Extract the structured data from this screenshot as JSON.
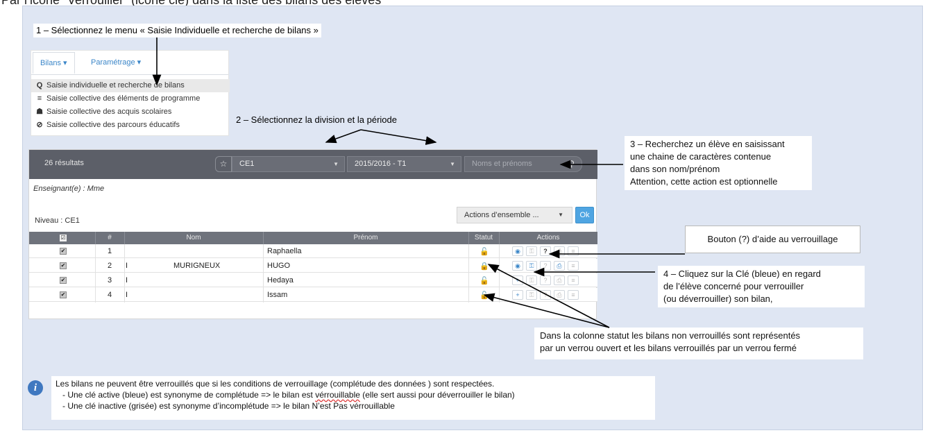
{
  "page_title": "Par l’icône “Verrouiller” (icône clé) dans la liste des bilans des élèves",
  "callouts": {
    "step1": "1 – Sélectionnez le menu « Saisie Individuelle et recherche de bilans »",
    "step2": "2 – Sélectionnez la division et la période",
    "step3_lines": [
      "3 – Recherchez un élève en saisissant",
      "une chaine de caractères contenue",
      "dans son nom/prénom",
      "Attention, cette action est optionnelle"
    ],
    "help_button": "Bouton (?) d’aide au verrouillage",
    "step4_lines": [
      "4 – Cliquez sur la Clé (bleue) en regard",
      "de l’élève concerné pour verrouiller",
      "(ou déverrouiller) son bilan,"
    ],
    "status_lines": [
      "Dans la colonne statut les bilans non verrouillés sont représentés",
      "par un verrou ouvert et les bilans verrouillés par un verrou fermé"
    ]
  },
  "menu": {
    "tabs": [
      {
        "label": "Bilans ▾"
      },
      {
        "label": "Paramétrage ▾"
      }
    ],
    "items": [
      {
        "icon": "search-icon",
        "glyph": "Q",
        "label": "Saisie individuelle et recherche de bilans"
      },
      {
        "icon": "list-icon",
        "glyph": "≡",
        "label": "Saisie collective des éléments de programme"
      },
      {
        "icon": "users-icon",
        "glyph": "☗",
        "label": "Saisie collective des acquis scolaires"
      },
      {
        "icon": "compass-icon",
        "glyph": "⊘",
        "label": "Saisie collective des parcours éducatifs"
      }
    ]
  },
  "app": {
    "results": "26 résultats",
    "division": "CE1",
    "period": "2015/2016 - T1",
    "search_placeholder": "Noms et prénoms",
    "teacher": "Enseignant(e) : Mme",
    "actions_label": "Actions d’ensemble ...",
    "ok_label": "Ok",
    "niveau": "Niveau : CE1",
    "columns": [
      "☑",
      "#",
      "Nom",
      "Prénom",
      "Statut",
      "Actions"
    ],
    "rows": [
      {
        "num": "1",
        "initial": "",
        "nom": "",
        "prenom": "Raphaella",
        "status": "open"
      },
      {
        "num": "2",
        "initial": "I",
        "nom": "MURIGNEUX",
        "prenom": "HUGO",
        "status": "locked"
      },
      {
        "num": "3",
        "initial": "I",
        "nom": "",
        "prenom": "Hedaya",
        "status": "open"
      },
      {
        "num": "4",
        "initial": "I",
        "nom": "",
        "prenom": "Issam",
        "status": "open"
      }
    ]
  },
  "info": {
    "line1": "Les bilans ne peuvent être verrouillés que si les conditions de verrouillage (complétude des données ) sont respectées.",
    "line2_a": "-   Une clé active (bleue) est synonyme de complétude => le bilan est ",
    "line2_b": "vérrouillable",
    "line2_c": " (elle sert aussi pour déverrouiller le bilan)",
    "line3": "-   Une clé inactive (grisée) est synonyme d’incomplétude => le bilan N’est Pas vérrouillable"
  },
  "colors": {
    "slide_bg": "#dfe6f3",
    "header_bg": "#5c5f68",
    "accent_blue": "#3b86c8",
    "lock_orange": "#f0a020",
    "ok_button": "#4fa5e2",
    "info_icon": "#3f78c0"
  }
}
